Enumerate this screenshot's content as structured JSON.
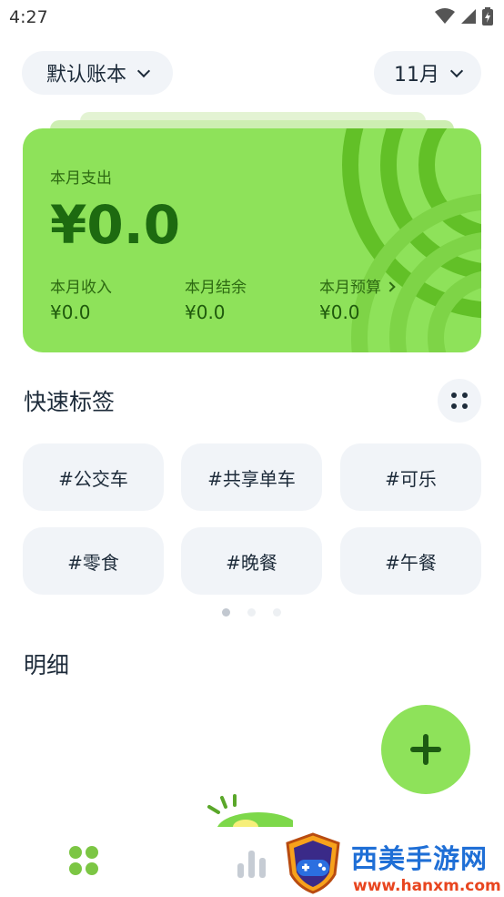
{
  "status_bar": {
    "time": "4:27",
    "icons": [
      "wifi-icon",
      "signal-icon",
      "battery-icon"
    ]
  },
  "header": {
    "account": "默认账本",
    "month": "11月"
  },
  "summary_card": {
    "expense_label": "本月支出",
    "expense_value": "¥0.0",
    "income_label": "本月收入",
    "income_value": "¥0.0",
    "balance_label": "本月结余",
    "balance_value": "¥0.0",
    "budget_label": "本月预算",
    "budget_value": "¥0.0"
  },
  "quick_tags": {
    "title": "快速标签",
    "tags": [
      "#公交车",
      "#共享单车",
      "#可乐",
      "#零食",
      "#晚餐",
      "#午餐"
    ],
    "page_count": 3,
    "active_page": 0
  },
  "details": {
    "title": "明细"
  },
  "bottom_nav": {
    "items": [
      "home-grid-icon",
      "stats-bars-icon"
    ]
  },
  "watermark": {
    "name": "西美手游网",
    "url": "www.hanxm.com"
  },
  "colors": {
    "accent_green": "#8ee25a",
    "dark_green_text": "#1d6a10",
    "chip_bg": "#f1f4f8",
    "nav_active": "#7cc644"
  }
}
